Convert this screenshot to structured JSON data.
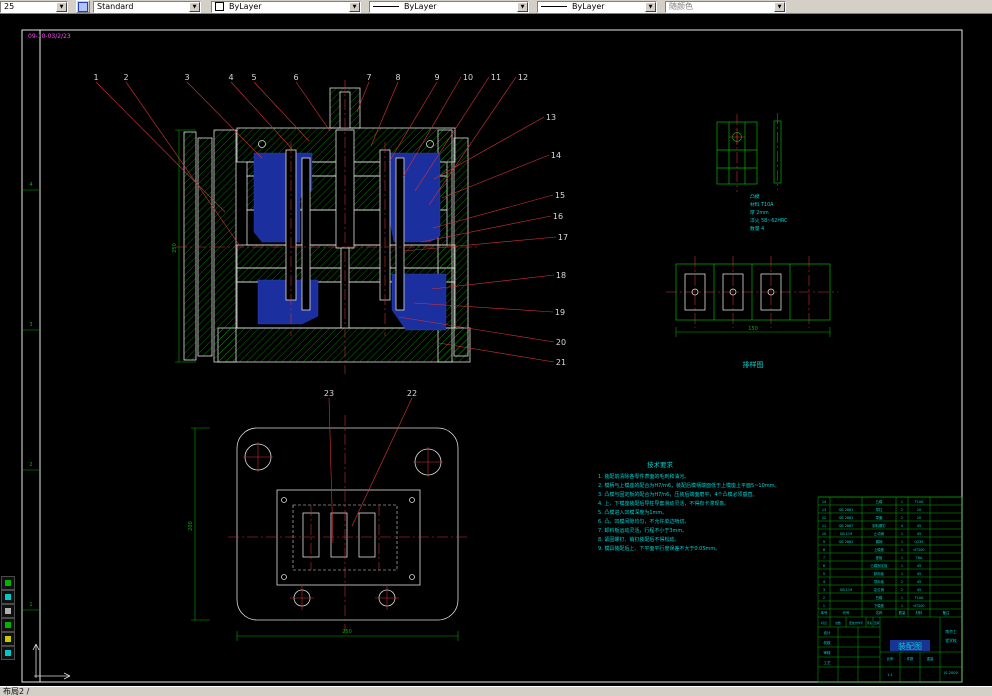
{
  "toolbar": {
    "zoom_value": "25",
    "style_value": "Standard",
    "color_value": "ByLayer",
    "linetype_value": "ByLayer",
    "lineweight_value": "ByLayer",
    "plot_style_value": "随颜色"
  },
  "side_toolbar": {
    "icons": [
      "layer-icon",
      "color-icon",
      "linetype-icon",
      "osnap-icon",
      "grid-icon",
      "ucs-icon"
    ]
  },
  "canvas": {
    "corner_label": "09-10-03/2/23",
    "zone_labels": [
      "4",
      "3",
      "2",
      "1"
    ],
    "callouts": [
      "1",
      "2",
      "3",
      "4",
      "5",
      "6",
      "7",
      "8",
      "9",
      "10",
      "11",
      "12",
      "13",
      "14",
      "15",
      "16",
      "17",
      "18",
      "19",
      "20",
      "21",
      "22",
      "23"
    ],
    "dims": {
      "main_height": "250",
      "lower_height": "200",
      "lower_width": "250",
      "strip_width": "150"
    },
    "detail_notes": [
      "凸模",
      "材料 T10A",
      "厚 2mm",
      "淬火 58~62HRC",
      "数量 4"
    ],
    "strip_label": "排样图",
    "tech_req": {
      "title": "技术要求",
      "lines": [
        "1. 装配前清除各零件表面的毛刺和油污。",
        "2. 模柄与上模座的配合为H7/m6，装配后模柄端面低于上模座上平面5~10mm。",
        "3. 凸模与固定板的配合为H7/n6，压装后端面磨平，4个凸模必须垂直。",
        "4. 上、下模座装配后导柱导套滑动灵活，不得有卡滞现象。",
        "5. 凸模进入凹模深度为1mm。",
        "6. 凸、凹模间隙均匀，不允许单边啃切。",
        "7. 卸料板运动灵活，行程不小于3mm。",
        "8. 紧固螺钉、销钉装配后不得松动。",
        "9. 模具装配后上、下平面平行度误差不大于0.05mm。"
      ]
    },
    "title_block": {
      "bom_headers": [
        "序号",
        "代号",
        "名称",
        "数量",
        "材料",
        "备注"
      ],
      "bom_rows": [
        [
          "1",
          "",
          "下模座",
          "1",
          "HT200",
          ""
        ],
        [
          "2",
          "",
          "凹模",
          "1",
          "T10A",
          ""
        ],
        [
          "3",
          "GB 119",
          "定位销",
          "2",
          "45",
          ""
        ],
        [
          "4",
          "",
          "导料板",
          "2",
          "45",
          ""
        ],
        [
          "5",
          "",
          "卸料板",
          "1",
          "45",
          ""
        ],
        [
          "6",
          "",
          "凸模固定板",
          "1",
          "45",
          ""
        ],
        [
          "7",
          "",
          "垫板",
          "1",
          "T8A",
          ""
        ],
        [
          "8",
          "",
          "上模座",
          "1",
          "HT200",
          ""
        ],
        [
          "9",
          "GB 2862",
          "模柄",
          "1",
          "Q235",
          ""
        ],
        [
          "10",
          "GB 119",
          "止动销",
          "1",
          "45",
          ""
        ],
        [
          "11",
          "GB 2867",
          "卸料螺钉",
          "4",
          "45",
          ""
        ],
        [
          "12",
          "GB 2861",
          "导套",
          "2",
          "20",
          ""
        ],
        [
          "13",
          "GB 2861",
          "导柱",
          "2",
          "20",
          ""
        ],
        [
          "14",
          "",
          "凸模",
          "1",
          "T10A",
          ""
        ]
      ],
      "change_labels": [
        "标记",
        "处数",
        "更改文件号",
        "签名",
        "日期"
      ],
      "role_labels": [
        "设计",
        "校核",
        "审核",
        "工艺"
      ],
      "title": "装配图",
      "school": "南京工程学校",
      "scale_label": "比例",
      "scale": "1:1",
      "qty_label": "件数",
      "weight_label": "重量",
      "drawing_no": "JS-2000"
    }
  },
  "statusbar": {
    "layout_tab": "布局2 /"
  },
  "colors": {
    "toolbar_bg": "#d4d0c8",
    "canvas_bg": "#000000",
    "outline": "#dcdcdc",
    "hatch_green": "#00a400",
    "centerline_red": "#d83434",
    "blue_fill": "#1c2f9e",
    "cyan_text": "#00cfcf",
    "green": "#00b400",
    "magenta": "#ff44ff",
    "callout_text": "#d9d9d9",
    "highlight_blue": "#1f3db0"
  }
}
